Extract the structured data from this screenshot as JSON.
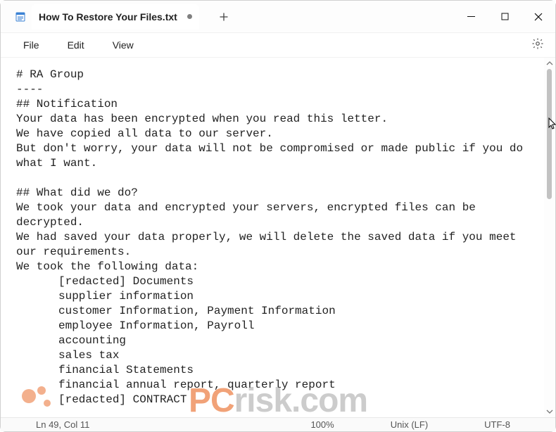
{
  "window": {
    "tab_title": "How To Restore Your Files.txt"
  },
  "menubar": {
    "file": "File",
    "edit": "Edit",
    "view": "View"
  },
  "document": {
    "lines": [
      "# RA Group",
      "----",
      "## Notification",
      "Your data has been encrypted when you read this letter.",
      "We have copied all data to our server.",
      "But don't worry, your data will not be compromised or made public if you do what I want.",
      "",
      "## What did we do?",
      "We took your data and encrypted your servers, encrypted files can be decrypted.",
      "We had saved your data properly, we will delete the saved data if you meet our requirements.",
      "We took the following data:"
    ],
    "indented": [
      "[redacted] Documents",
      "supplier information",
      "customer Information, Payment Information",
      "employee Information, Payroll",
      "accounting",
      "sales tax",
      "financial Statements",
      "financial annual report, quarterly report",
      "[redacted] CONTRACT"
    ]
  },
  "statusbar": {
    "position": "Ln 49, Col 11",
    "zoom": "100%",
    "line_ending": "Unix (LF)",
    "encoding": "UTF-8"
  },
  "watermark": {
    "full": "PCrisk.com",
    "prefix": "PC",
    "suffix": "risk.com"
  }
}
